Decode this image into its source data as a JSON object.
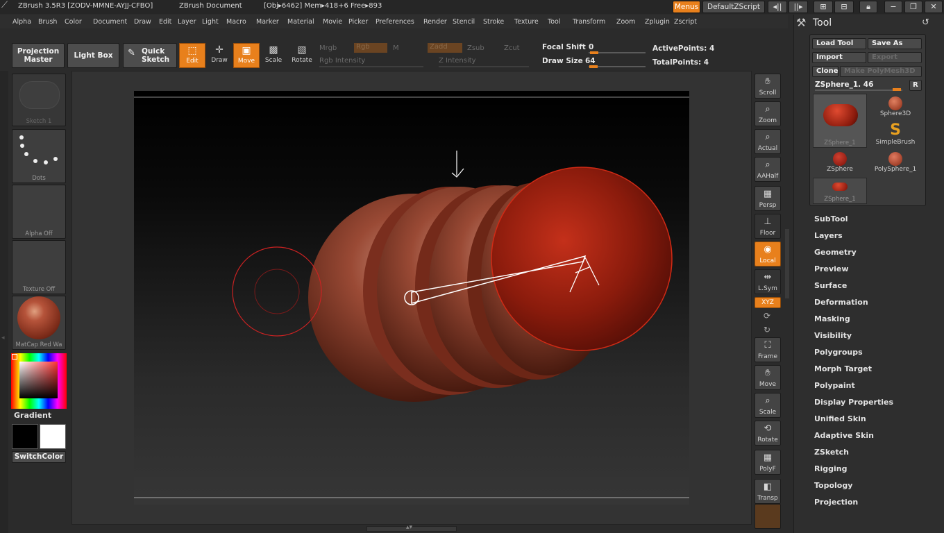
{
  "titlebar": {
    "app": "ZBrush 3.5R3 [ZODV-MMNE-AYJJ-CFBO]",
    "document": "ZBrush Document",
    "obj_info": "[Obj▸6462] Mem▸418+6 Free▸893",
    "menus_button": "Menus",
    "script_button": "DefaultZScript"
  },
  "menubar": [
    "Alpha",
    "Brush",
    "Color",
    "Document",
    "Draw",
    "Edit",
    "Layer",
    "Light",
    "Macro",
    "Marker",
    "Material",
    "Movie",
    "Picker",
    "Preferences",
    "Render",
    "Stencil",
    "Stroke",
    "Texture",
    "Tool",
    "Transform",
    "Zoom",
    "Zplugin",
    "Zscript"
  ],
  "toolbar": {
    "projection_master": "Projection Master",
    "light_box": "Light Box",
    "quick_sketch": "Quick Sketch",
    "edit": "Edit",
    "draw": "Draw",
    "move": "Move",
    "scale": "Scale",
    "rotate": "Rotate",
    "mrgb": "Mrgb",
    "rgb": "Rgb",
    "m": "M",
    "zadd": "Zadd",
    "zsub": "Zsub",
    "zcut": "Zcut",
    "rgb_intensity": "Rgb Intensity",
    "z_intensity": "Z Intensity",
    "focal_shift_label": "Focal Shift",
    "focal_shift_value": "0",
    "draw_size_label": "Draw Size",
    "draw_size_value": "64",
    "active_points": "ActivePoints: 4",
    "total_points": "TotalPoints: 4"
  },
  "leftcol": {
    "sketch": "Sketch 1",
    "dots": "Dots",
    "alpha": "Alpha Off",
    "texture": "Texture Off",
    "material": "MatCap Red Wa",
    "gradient": "Gradient",
    "switchcolor": "SwitchColor"
  },
  "rightdock": [
    {
      "name": "scroll",
      "label": "Scroll",
      "icon": "hand-icon"
    },
    {
      "name": "zoom",
      "label": "Zoom",
      "icon": "magnifier-icon"
    },
    {
      "name": "actual",
      "label": "Actual",
      "icon": "magnifier-icon"
    },
    {
      "name": "aahalf",
      "label": "AAHalf",
      "icon": "magnifier-icon"
    },
    {
      "name": "persp",
      "label": "Persp",
      "icon": "grid-icon"
    },
    {
      "name": "floor",
      "label": "Floor",
      "icon": "floor-icon"
    },
    {
      "name": "local",
      "label": "Local",
      "icon": "local-icon"
    },
    {
      "name": "lsym",
      "label": "L.Sym",
      "icon": "symmetry-icon"
    },
    {
      "name": "xyz",
      "label": "XYZ",
      "icon": "xyz-icon"
    },
    {
      "name": "frame",
      "label": "Frame",
      "icon": "frame-icon"
    },
    {
      "name": "move",
      "label": "Move",
      "icon": "hand-icon"
    },
    {
      "name": "scale",
      "label": "Scale",
      "icon": "magnifier-icon"
    },
    {
      "name": "rotate",
      "label": "Rotate",
      "icon": "rotate-icon"
    },
    {
      "name": "polyf",
      "label": "PolyF",
      "icon": "grid-icon"
    },
    {
      "name": "transp",
      "label": "Transp",
      "icon": "transparency-icon"
    }
  ],
  "toolpanel": {
    "title": "Tool",
    "load_tool": "Load Tool",
    "save_as": "Save As",
    "import": "Import",
    "export": "Export",
    "clone": "Clone",
    "make_polymesh": "Make PolyMesh3D",
    "current_tool": "ZSphere_1. 46",
    "r_button": "R",
    "tools": [
      "ZSphere_1",
      "Sphere3D",
      "SimpleBrush",
      "ZSphere",
      "PolySphere_1",
      "ZSphere_1"
    ],
    "sections": [
      "SubTool",
      "Layers",
      "Geometry",
      "Preview",
      "Surface",
      "Deformation",
      "Masking",
      "Visibility",
      "Polygroups",
      "Morph Target",
      "Polypaint",
      "Display Properties",
      "Unified Skin",
      "Adaptive Skin",
      "ZSketch",
      "Rigging",
      "Topology",
      "Projection"
    ]
  },
  "colors": {
    "accent": "#e8801c",
    "background": "#2b2b2b",
    "model_red": "#a8321e"
  }
}
